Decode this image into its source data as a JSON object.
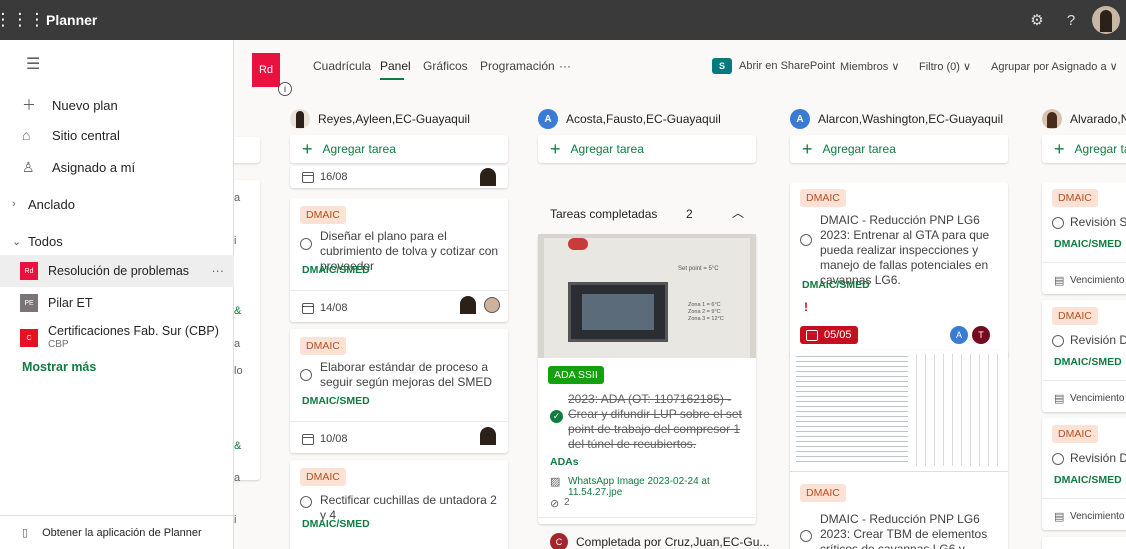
{
  "app": {
    "name": "Planner"
  },
  "topbar": {
    "settings_icon": "gear-icon",
    "help": "?"
  },
  "sidebar": {
    "new_plan": "Nuevo plan",
    "hub": "Sitio central",
    "assigned": "Asignado a mí",
    "pinned": "Anclado",
    "all": "Todos",
    "plans": [
      {
        "badge": "Rd",
        "name": "Resolución de problemas",
        "color": "#e8113f"
      },
      {
        "badge": "PE",
        "name": "Pilar ET",
        "color": "#7a7574"
      },
      {
        "badge": "C",
        "name": "Certificaciones Fab. Sur (CBP)",
        "sub": "CBP",
        "color": "#e81123"
      }
    ],
    "more": "···",
    "show_more": "Mostrar más",
    "get_app": "Obtener la aplicación de Planner"
  },
  "header": {
    "plan_badge": "Rd",
    "info": "i",
    "views": [
      "Cuadrícula",
      "Panel",
      "Gráficos",
      "Programación",
      "···"
    ],
    "sharepoint_badge": "S",
    "open_sharepoint": "Abrir en SharePoint",
    "members": "Miembros ∨",
    "filter": "Filtro (0) ∨",
    "group": "Agrupar por Asignado a ∨"
  },
  "columns": [
    {
      "name": "Reyes,Ayleen,EC-Guayaquil"
    },
    {
      "name": "Acosta,Fausto,EC-Guayaquil",
      "initial": "A"
    },
    {
      "name": "Alarcon,Washington,EC-Guayaquil",
      "initial": "A"
    },
    {
      "name": "Alvarado,N"
    }
  ],
  "add_task": "Agregar tarea",
  "add_task_cut": "Agregar ta",
  "leftcut": [
    "a",
    "i",
    "a",
    "lo",
    "a",
    "i"
  ],
  "col1": {
    "date0": "16/08",
    "cards": [
      {
        "tag": "DMAIC",
        "title": "Diseñar el plano para el cubrimiento de tolva y cotizar con proveedor",
        "label": "DMAIC/SMED",
        "date": "14/08"
      },
      {
        "tag": "DMAIC",
        "title": "Elaborar estándar de proceso a seguir según mejoras del SMED",
        "label": "DMAIC/SMED",
        "date": "10/08"
      },
      {
        "tag": "DMAIC",
        "title": "Rectificar cuchillas de untadora 2 y 4",
        "label": "DMAIC/SMED"
      }
    ]
  },
  "col2": {
    "completed": "Tareas completadas",
    "completed_count": "2",
    "card": {
      "tag": "ADA SSII",
      "title": "2023: ADA (OT: 1107162185) - Crear y difundir LUP sobre el set point de trabajo del compresor 1 del túnel de recubiertos.",
      "label": "ADAs",
      "attachment": "WhatsApp Image 2023-02-24 at 11.54.27.jpe",
      "links": "2"
    },
    "photo_text": [
      "Set point = 5°C",
      "Zona 1 = 6°C",
      "Zona 2 = 9°C",
      "Zona 3 = 12°C"
    ],
    "completed_by": "Completada por Cruz,Juan,EC-Gu...",
    "completed_by_initial": "C"
  },
  "col3": {
    "card1": {
      "tag": "DMAIC",
      "title": "DMAIC - Reducción PNP LG6 2023: Entrenar al GTA para que pueda realizar inspecciones y manejo de fallas potenciales en cavannas LG6.",
      "label": "DMAIC/SMED",
      "priority": "!",
      "date": "05/05",
      "a1": "A",
      "a2": "T"
    },
    "card2": {
      "tag": "DMAIC",
      "title": "DMAIC - Reducción PNP LG6 2023: Crear TBM de elementos críticos de cavannas LG6 y asociar al plan de"
    }
  },
  "col4": {
    "cards": [
      {
        "tag": "DMAIC",
        "title": "Revisión SM",
        "label": "DMAIC/SMED"
      },
      {
        "tag": "DMAIC",
        "title": "Revisión DN",
        "label": "DMAIC/SMED"
      },
      {
        "tag": "DMAIC",
        "title": "Revisión DN",
        "label": "DMAIC/SMED"
      }
    ],
    "due": "Vencimiento"
  }
}
